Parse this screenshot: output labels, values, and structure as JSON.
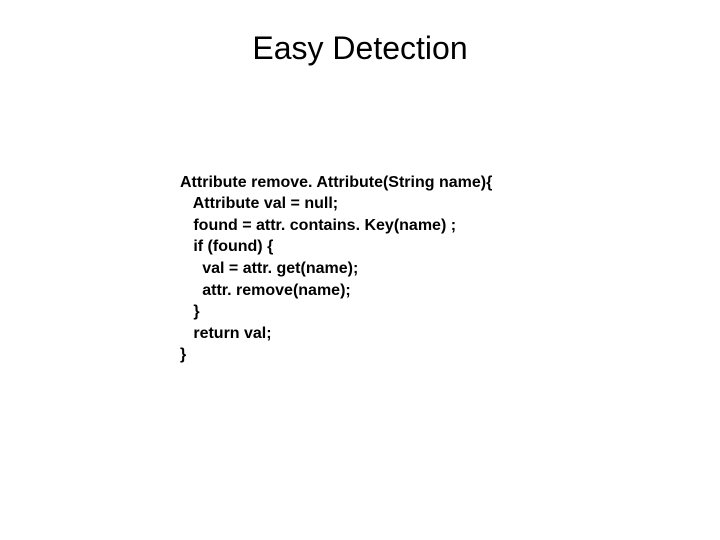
{
  "title": "Easy Detection",
  "code": {
    "line1": "Attribute remove. Attribute(String name){",
    "line2": "   Attribute val = null;",
    "line3": "   found = attr. contains. Key(name) ;",
    "line4": "   if (found) {",
    "line5": "     val = attr. get(name);",
    "line6": "     attr. remove(name);",
    "line7": "   }",
    "line8": "   return val;",
    "line9": "}"
  }
}
